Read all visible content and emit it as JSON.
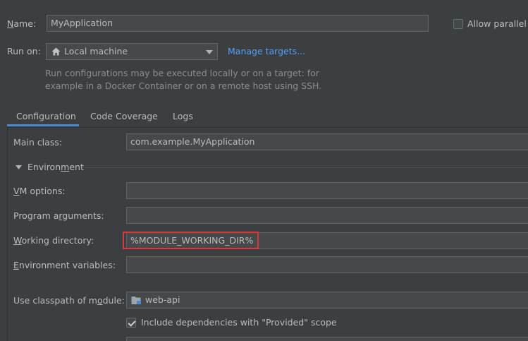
{
  "name": {
    "label": "Name:",
    "mnemonic": "N",
    "rest": "ame:",
    "value": "MyApplication"
  },
  "allow_parallel": {
    "label": "Allow parallel r",
    "checked": false
  },
  "run_on": {
    "label": "Run on:",
    "selected": "Local machine",
    "icon": "home-icon",
    "manage_link": "Manage targets...",
    "hint_line1": "Run configurations may be executed locally or on a target: for",
    "hint_line2": "example in a Docker Container or on a remote host using SSH."
  },
  "tabs": [
    {
      "label": "Configuration",
      "active": true
    },
    {
      "label": "Code Coverage",
      "active": false
    },
    {
      "label": "Logs",
      "active": false
    }
  ],
  "main_class": {
    "label": "Main class:",
    "value": "com.example.MyApplication"
  },
  "environment": {
    "label_pre": "Environ",
    "mnemonic": "m",
    "label_post": "ent"
  },
  "vm_options": {
    "mnemonic": "V",
    "rest": "M options:",
    "value": ""
  },
  "program_arguments": {
    "pre": "Program a",
    "mnemonic": "r",
    "post": "guments:",
    "value": ""
  },
  "working_directory": {
    "mnemonic": "W",
    "rest": "orking directory:",
    "value": "%MODULE_WORKING_DIR%",
    "highlight_color": "#e0353b"
  },
  "environment_variables": {
    "mnemonic": "E",
    "rest": "nvironment variables:",
    "value": ""
  },
  "classpath_module": {
    "pre": "Use classpath of m",
    "mnemonic": "o",
    "post": "dule:",
    "value": "web-api",
    "icon": "module-folder-icon"
  },
  "include_provided": {
    "label": "Include dependencies with \"Provided\" scope",
    "checked": true
  },
  "colors": {
    "accent": "#4a88c7",
    "link": "#589df6",
    "background": "#3c3f41",
    "field": "#45494a"
  }
}
